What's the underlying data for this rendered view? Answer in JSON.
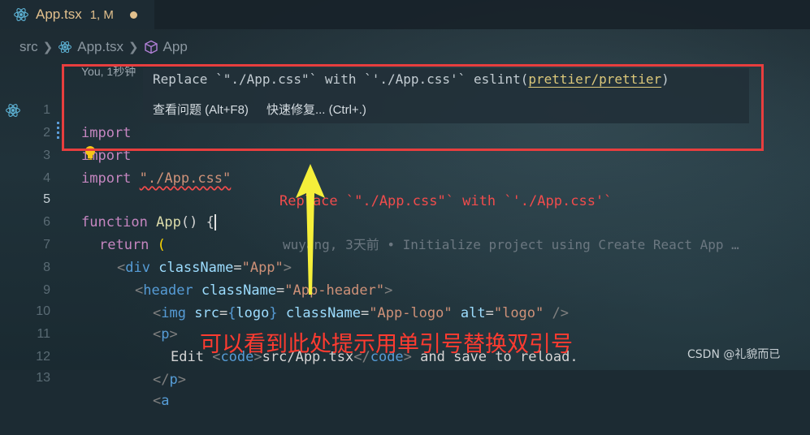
{
  "tab": {
    "filename": "App.tsx",
    "status": "1, M"
  },
  "breadcrumb": {
    "folder": "src",
    "file": "App.tsx",
    "symbol": "App"
  },
  "blame_header": "You, 1秒钟",
  "hover": {
    "message_prefix": "Replace `\"./App.css\"` with `'./App.css'` eslint(",
    "rule_link": "prettier/prettier",
    "message_suffix": ")",
    "action_view": "查看问题 (Alt+F8)",
    "action_quickfix": "快速修复... (Ctrl+.)"
  },
  "lines": {
    "l1": {
      "num": "1",
      "kw": "import"
    },
    "l2": {
      "num": "2",
      "kw": "import"
    },
    "l3": {
      "num": "3",
      "kw": "import",
      "str": "\"./App.css\"",
      "error": "Replace `\"./App.css\"` with `'./App.css'`"
    },
    "l4": {
      "num": "4"
    },
    "l5": {
      "num": "5",
      "kw": "function",
      "fn": "App",
      "rest": "() {",
      "blame": "wuyang, 3天前 • Initialize project using Create React App …"
    },
    "l6": {
      "num": "6",
      "kw": "return",
      "rest": "("
    },
    "l7": {
      "num": "7",
      "tag": "div",
      "attr": "className",
      "str": "\"App\""
    },
    "l8": {
      "num": "8",
      "tag": "header",
      "attr": "className",
      "str": "\"App-header\""
    },
    "l9": {
      "num": "9",
      "tag": "img",
      "attr1": "src",
      "var": "logo",
      "attr2": "className",
      "str1": "\"App-logo\"",
      "attr3": "alt",
      "str2": "\"logo\""
    },
    "l10": {
      "num": "10",
      "tag": "p"
    },
    "l11": {
      "num": "11",
      "text1": "Edit ",
      "tag": "code",
      "text2": "src/App.tsx",
      "text3": " and save to reload."
    },
    "l12": {
      "num": "12",
      "tag": "p"
    },
    "l13": {
      "num": "13",
      "tag": "a"
    }
  },
  "annotation": "可以看到此处提示用单引号替换双引号",
  "watermark": "CSDN @礼貌而已",
  "colors": {
    "highlight_box": "#e83e3e",
    "annotation": "#ff3b30",
    "arrow": "#f5ef3a",
    "modified_tab": "#e2c08d"
  }
}
